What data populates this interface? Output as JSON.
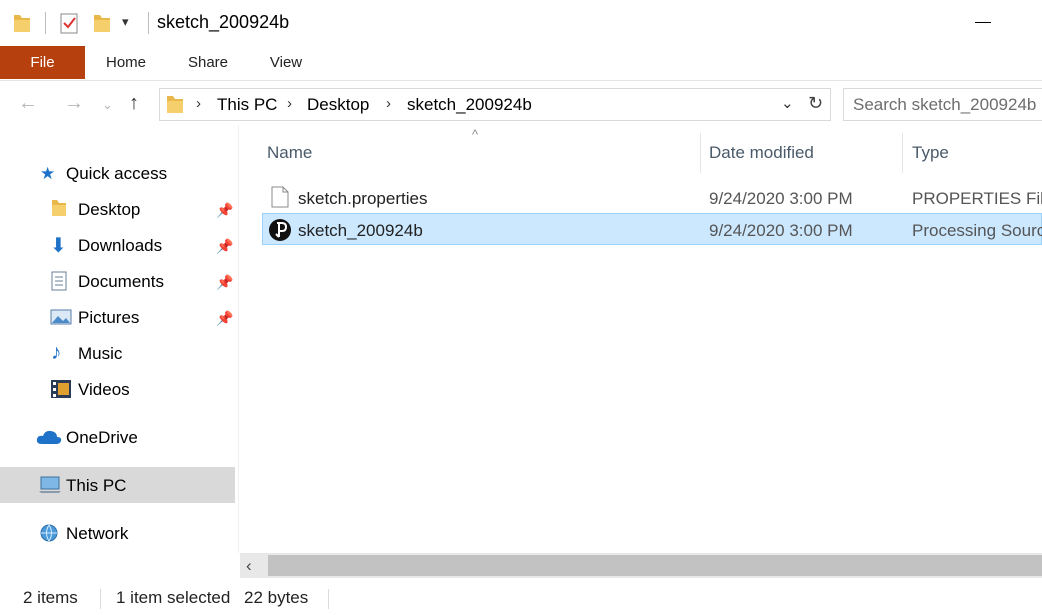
{
  "window": {
    "title": "sketch_200924b"
  },
  "ribbon": {
    "tabs": [
      "File",
      "Home",
      "Share",
      "View"
    ]
  },
  "address": {
    "crumbs": [
      "This PC",
      "Desktop",
      "sketch_200924b"
    ],
    "search_placeholder": "Search sketch_200924b"
  },
  "nav": {
    "quick_access": "Quick access",
    "items": [
      "Desktop",
      "Downloads",
      "Documents",
      "Pictures",
      "Music",
      "Videos"
    ],
    "onedrive": "OneDrive",
    "this_pc": "This PC",
    "network": "Network"
  },
  "columns": {
    "name": "Name",
    "date": "Date modified",
    "type": "Type"
  },
  "files": [
    {
      "name": "sketch.properties",
      "date": "9/24/2020 3:00 PM",
      "type": "PROPERTIES File"
    },
    {
      "name": "sketch_200924b",
      "date": "9/24/2020 3:00 PM",
      "type": "Processing Source"
    }
  ],
  "status": {
    "count": "2 items",
    "selection": "1 item selected",
    "size": "22 bytes"
  },
  "colors": {
    "file_tab": "#b7410e",
    "selection": "#cce8ff",
    "selection_border": "#99d1ff",
    "nav_selected": "#d9d9d9"
  }
}
